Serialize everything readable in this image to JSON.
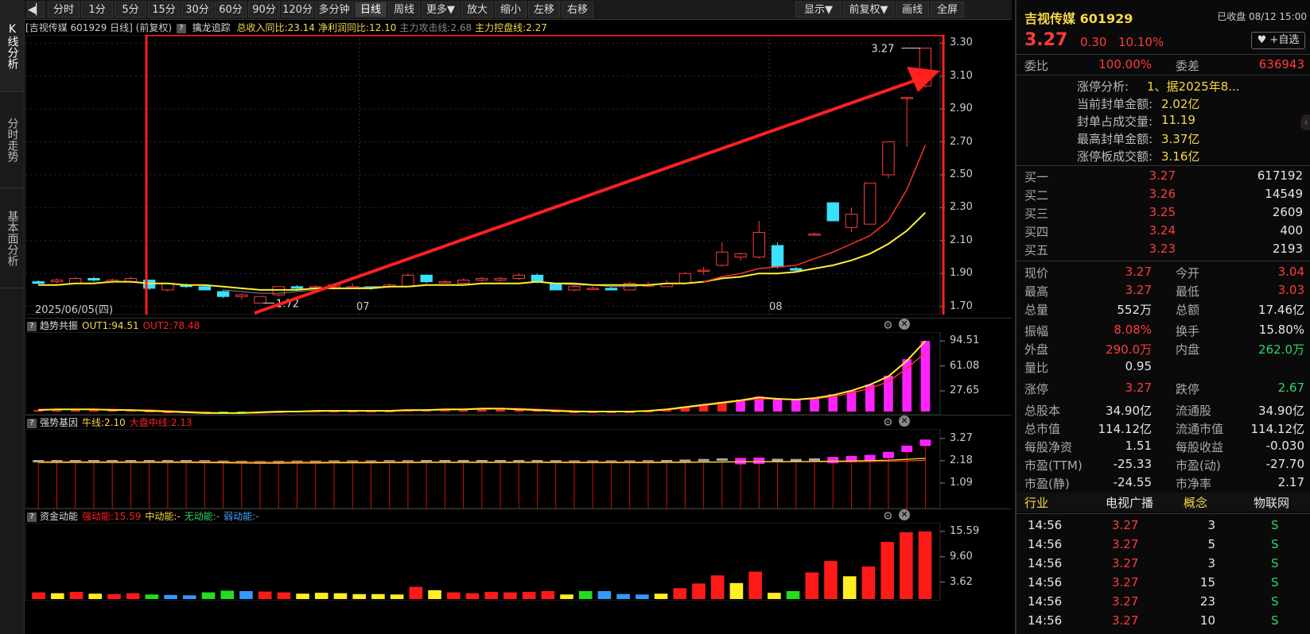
{
  "side_tabs": [
    "K线分析",
    "分时走势",
    "基本面分析"
  ],
  "toolbar": {
    "left_items": [
      "分时",
      "1分",
      "5分",
      "15分",
      "30分",
      "60分",
      "90分",
      "120分",
      "多分钟",
      "日线",
      "周线",
      "更多▼",
      "放大",
      "缩小",
      "左移",
      "右移"
    ],
    "active": "日线",
    "right_items": [
      "显示▼",
      "前复权▼",
      "画线",
      "全屏"
    ]
  },
  "main_panel": {
    "header_stock": "吉视传媒 601929 日线",
    "header_adj": "(前复权)",
    "indicator": "擒龙追踪",
    "items": [
      {
        "text": "总收入同比:23.14",
        "color": "#f7d84a"
      },
      {
        "text": "净利润同比:12.10",
        "color": "#f7d84a"
      },
      {
        "text": "主力攻击线:2.68",
        "color": "#888888"
      },
      {
        "text": "主力控盘线:2.27",
        "color": "#f7d84a"
      }
    ],
    "start_date": "2025/06/05(四)",
    "month_labels": [
      "07",
      "08"
    ],
    "low_label": "1.72",
    "high_label": "3.27",
    "y_ticks": [
      "3.30",
      "3.10",
      "2.90",
      "2.70",
      "2.50",
      "2.30",
      "2.10",
      "1.90",
      "1.70"
    ]
  },
  "sub_panels": [
    {
      "name": "趋势共振",
      "items": [
        {
          "text": "OUT1:94.51",
          "color": "#f7d84a"
        },
        {
          "text": "OUT2:78.48",
          "color": "#ff2020"
        }
      ],
      "ticks": [
        "94.51",
        "61.08",
        "27.65"
      ]
    },
    {
      "name": "强势基因",
      "items": [
        {
          "text": "牛线:2.10",
          "color": "#f7d84a"
        },
        {
          "text": "大盘中线:2.13",
          "color": "#ff2020"
        }
      ],
      "ticks": [
        "3.27",
        "2.18",
        "1.09"
      ]
    },
    {
      "name": "资金动能",
      "items": [
        {
          "text": "强动能:15.59",
          "color": "#ff2020"
        },
        {
          "text": "中动能:-",
          "color": "#f7d84a"
        },
        {
          "text": "无动能:-",
          "color": "#2fd66a"
        },
        {
          "text": "弱动能:-",
          "color": "#4aa3ff"
        }
      ],
      "ticks": [
        "15.59",
        "9.60",
        "3.62"
      ]
    }
  ],
  "chart_data": [
    {
      "type": "candlestick",
      "ylim": [
        1.65,
        3.35
      ],
      "candles": [
        {
          "o": 1.85,
          "h": 1.86,
          "l": 1.83,
          "c": 1.84
        },
        {
          "o": 1.85,
          "h": 1.87,
          "l": 1.84,
          "c": 1.86
        },
        {
          "o": 1.84,
          "h": 1.88,
          "l": 1.84,
          "c": 1.87
        },
        {
          "o": 1.87,
          "h": 1.88,
          "l": 1.85,
          "c": 1.86
        },
        {
          "o": 1.85,
          "h": 1.87,
          "l": 1.84,
          "c": 1.86
        },
        {
          "o": 1.85,
          "h": 1.88,
          "l": 1.84,
          "c": 1.87
        },
        {
          "o": 1.86,
          "h": 1.86,
          "l": 1.8,
          "c": 1.81
        },
        {
          "o": 1.8,
          "h": 1.84,
          "l": 1.79,
          "c": 1.84
        },
        {
          "o": 1.83,
          "h": 1.84,
          "l": 1.81,
          "c": 1.82
        },
        {
          "o": 1.82,
          "h": 1.83,
          "l": 1.8,
          "c": 1.8
        },
        {
          "o": 1.79,
          "h": 1.8,
          "l": 1.75,
          "c": 1.76
        },
        {
          "o": 1.76,
          "h": 1.78,
          "l": 1.74,
          "c": 1.77
        },
        {
          "o": 1.72,
          "h": 1.76,
          "l": 1.72,
          "c": 1.76
        },
        {
          "o": 1.77,
          "h": 1.82,
          "l": 1.76,
          "c": 1.82
        },
        {
          "o": 1.82,
          "h": 1.83,
          "l": 1.8,
          "c": 1.81
        },
        {
          "o": 1.82,
          "h": 1.83,
          "l": 1.8,
          "c": 1.82
        },
        {
          "o": 1.82,
          "h": 1.84,
          "l": 1.8,
          "c": 1.83
        },
        {
          "o": 1.82,
          "h": 1.84,
          "l": 1.81,
          "c": 1.82
        },
        {
          "o": 1.82,
          "h": 1.82,
          "l": 1.8,
          "c": 1.81
        },
        {
          "o": 1.82,
          "h": 1.84,
          "l": 1.81,
          "c": 1.83
        },
        {
          "o": 1.82,
          "h": 1.9,
          "l": 1.82,
          "c": 1.89
        },
        {
          "o": 1.89,
          "h": 1.89,
          "l": 1.84,
          "c": 1.85
        },
        {
          "o": 1.85,
          "h": 1.86,
          "l": 1.84,
          "c": 1.85
        },
        {
          "o": 1.84,
          "h": 1.87,
          "l": 1.84,
          "c": 1.86
        },
        {
          "o": 1.86,
          "h": 1.88,
          "l": 1.85,
          "c": 1.87
        },
        {
          "o": 1.86,
          "h": 1.88,
          "l": 1.85,
          "c": 1.87
        },
        {
          "o": 1.87,
          "h": 1.9,
          "l": 1.86,
          "c": 1.89
        },
        {
          "o": 1.89,
          "h": 1.9,
          "l": 1.84,
          "c": 1.85
        },
        {
          "o": 1.84,
          "h": 1.84,
          "l": 1.8,
          "c": 1.8
        },
        {
          "o": 1.8,
          "h": 1.83,
          "l": 1.79,
          "c": 1.82
        },
        {
          "o": 1.81,
          "h": 1.82,
          "l": 1.8,
          "c": 1.81
        },
        {
          "o": 1.81,
          "h": 1.82,
          "l": 1.8,
          "c": 1.8
        },
        {
          "o": 1.8,
          "h": 1.85,
          "l": 1.8,
          "c": 1.84
        },
        {
          "o": 1.83,
          "h": 1.85,
          "l": 1.82,
          "c": 1.83
        },
        {
          "o": 1.82,
          "h": 1.86,
          "l": 1.82,
          "c": 1.84
        },
        {
          "o": 1.84,
          "h": 1.91,
          "l": 1.84,
          "c": 1.9
        },
        {
          "o": 1.92,
          "h": 1.94,
          "l": 1.89,
          "c": 1.92
        },
        {
          "o": 1.95,
          "h": 2.09,
          "l": 1.94,
          "c": 2.03
        },
        {
          "o": 2.0,
          "h": 2.03,
          "l": 1.98,
          "c": 2.02
        },
        {
          "o": 2.0,
          "h": 2.22,
          "l": 1.99,
          "c": 2.15
        },
        {
          "o": 2.07,
          "h": 2.09,
          "l": 1.93,
          "c": 1.94
        },
        {
          "o": 1.93,
          "h": 1.94,
          "l": 1.91,
          "c": 1.92
        },
        {
          "o": 2.14,
          "h": 2.15,
          "l": 2.14,
          "c": 2.14
        },
        {
          "o": 2.33,
          "h": 2.33,
          "l": 2.22,
          "c": 2.22
        },
        {
          "o": 2.18,
          "h": 2.3,
          "l": 2.15,
          "c": 2.26
        },
        {
          "o": 2.2,
          "h": 2.45,
          "l": 2.2,
          "c": 2.45
        },
        {
          "o": 2.5,
          "h": 2.7,
          "l": 2.48,
          "c": 2.7
        },
        {
          "o": 2.97,
          "h": 2.97,
          "l": 2.67,
          "c": 2.97
        },
        {
          "o": 3.04,
          "h": 3.27,
          "l": 3.03,
          "c": 3.27
        }
      ],
      "ma_red": [
        null,
        null,
        null,
        null,
        null,
        null,
        null,
        null,
        null,
        null,
        null,
        null,
        null,
        null,
        null,
        null,
        null,
        null,
        null,
        null,
        null,
        null,
        null,
        null,
        null,
        null,
        null,
        null,
        null,
        null,
        null,
        null,
        null,
        null,
        null,
        null,
        1.85,
        1.88,
        1.9,
        1.93,
        1.94,
        1.95,
        1.99,
        2.03,
        2.08,
        2.13,
        2.22,
        2.41,
        2.68
      ],
      "ma_yellow": [
        1.83,
        1.83,
        1.84,
        1.84,
        1.85,
        1.85,
        1.84,
        1.84,
        1.83,
        1.83,
        1.82,
        1.81,
        1.8,
        1.8,
        1.8,
        1.81,
        1.81,
        1.81,
        1.81,
        1.82,
        1.82,
        1.83,
        1.83,
        1.83,
        1.84,
        1.84,
        1.84,
        1.85,
        1.84,
        1.84,
        1.83,
        1.83,
        1.83,
        1.83,
        1.84,
        1.84,
        1.85,
        1.87,
        1.88,
        1.9,
        1.9,
        1.91,
        1.93,
        1.95,
        1.98,
        2.02,
        2.08,
        2.16,
        2.27
      ],
      "ma_grey": [
        null,
        null,
        null,
        null,
        null,
        null,
        null,
        null,
        null,
        null,
        1.8,
        1.79,
        1.78,
        1.78,
        1.79,
        1.8,
        1.81,
        1.81,
        1.82,
        1.82,
        1.82,
        1.83,
        1.83,
        1.83,
        1.84,
        1.84,
        1.84,
        1.85,
        1.84,
        1.83,
        1.83,
        1.82,
        1.82,
        1.83,
        1.84,
        null,
        null,
        null,
        null,
        null,
        null,
        null,
        null,
        null,
        null,
        null,
        null,
        null,
        null
      ]
    },
    {
      "type": "bar",
      "ylim": [
        0,
        100
      ],
      "values": [
        2,
        3,
        3,
        3,
        2,
        2,
        1,
        0,
        0,
        -1,
        -2,
        -2,
        -1,
        0,
        1,
        1,
        1,
        1,
        1,
        1,
        2,
        2,
        3,
        3,
        4,
        4,
        3,
        2,
        1,
        0,
        0,
        0,
        0,
        1,
        3,
        6,
        9,
        13,
        16,
        20,
        17,
        16,
        18,
        23,
        28,
        36,
        48,
        70,
        94.51
      ],
      "line_yellow": [
        2,
        3,
        3,
        3,
        2,
        2,
        1,
        0,
        -1,
        -2,
        -2,
        -2,
        -1,
        0,
        0,
        1,
        1,
        1,
        1,
        1,
        2,
        2,
        3,
        3,
        4,
        4,
        3,
        2,
        1,
        0,
        0,
        0,
        0,
        1,
        3,
        6,
        9,
        12,
        15,
        19,
        17,
        16,
        18,
        22,
        28,
        36,
        47,
        68,
        94.51
      ],
      "line_red": [
        3,
        3,
        3,
        3,
        3,
        2,
        2,
        1,
        0,
        -1,
        -2,
        -2,
        -2,
        -1,
        0,
        0,
        1,
        1,
        1,
        1,
        1,
        2,
        2,
        3,
        3,
        4,
        4,
        3,
        2,
        1,
        0,
        0,
        0,
        1,
        2,
        5,
        8,
        11,
        14,
        17,
        17,
        16,
        17,
        20,
        25,
        31,
        40,
        58,
        78.48
      ]
    },
    {
      "type": "bar",
      "ylim": [
        0,
        3.5
      ],
      "values": [
        2.1,
        2.1,
        2.1,
        2.1,
        2.1,
        2.1,
        2.1,
        2.1,
        2.1,
        2.09,
        2.07,
        2.06,
        2.05,
        2.06,
        2.07,
        2.07,
        2.08,
        2.08,
        2.08,
        2.09,
        2.09,
        2.1,
        2.1,
        2.1,
        2.1,
        2.1,
        2.1,
        2.1,
        2.09,
        2.08,
        2.08,
        2.08,
        2.08,
        2.09,
        2.1,
        2.12,
        2.15,
        2.18,
        2.2,
        2.22,
        2.16,
        2.15,
        2.18,
        2.25,
        2.3,
        2.35,
        2.5,
        2.8,
        3.1
      ],
      "line_yellow": [
        2.1,
        2.1,
        2.1,
        2.1,
        2.1,
        2.1,
        2.1,
        2.1,
        2.1,
        2.09,
        2.08,
        2.07,
        2.06,
        2.06,
        2.07,
        2.07,
        2.08,
        2.08,
        2.08,
        2.09,
        2.09,
        2.1,
        2.1,
        2.1,
        2.1,
        2.1,
        2.1,
        2.1,
        2.1,
        2.09,
        2.09,
        2.09,
        2.09,
        2.09,
        2.1,
        2.1,
        2.11,
        2.12,
        2.13,
        2.14,
        2.14,
        2.14,
        2.15,
        2.16,
        2.17,
        2.19,
        2.21,
        2.25,
        2.3
      ],
      "line_red": [
        2.13,
        2.13,
        2.13,
        2.13,
        2.13,
        2.13,
        2.13,
        2.13,
        2.13,
        2.13,
        2.12,
        2.12,
        2.12,
        2.12,
        2.12,
        2.12,
        2.12,
        2.12,
        2.12,
        2.12,
        2.12,
        2.12,
        2.12,
        2.12,
        2.12,
        2.12,
        2.12,
        2.12,
        2.12,
        2.12,
        2.12,
        2.12,
        2.12,
        2.12,
        2.12,
        2.12,
        2.12,
        2.12,
        2.13,
        2.13,
        2.13,
        2.13,
        2.13,
        2.13,
        2.13,
        2.14,
        2.15,
        2.17,
        2.2
      ]
    },
    {
      "type": "bar",
      "ylim": [
        0,
        16.5
      ],
      "values": [
        1.2,
        1.0,
        1.3,
        0.9,
        0.8,
        1.0,
        0.7,
        0.6,
        0.5,
        1.2,
        1.6,
        1.5,
        1.4,
        1.2,
        0.9,
        1.1,
        1.0,
        0.8,
        0.8,
        0.7,
        2.5,
        1.7,
        1.2,
        1.0,
        1.3,
        1.2,
        1.3,
        1.5,
        0.7,
        1.5,
        1.5,
        0.8,
        0.7,
        0.9,
        2.2,
        3.3,
        5.2,
        3.4,
        6.1,
        1.1,
        1.5,
        5.9,
        8.6,
        5.0,
        7.3,
        13.1,
        15.4,
        15.59
      ],
      "colors": [
        "r",
        "y",
        "r",
        "y",
        "r",
        "r",
        "g",
        "b",
        "b",
        "g",
        "g",
        "b",
        "r",
        "r",
        "y",
        "y",
        "y",
        "y",
        "y",
        "y",
        "r",
        "y",
        "r",
        "r",
        "r",
        "r",
        "r",
        "r",
        "y",
        "g",
        "b",
        "b",
        "b",
        "y",
        "r",
        "r",
        "r",
        "y",
        "r",
        "y",
        "g",
        "r",
        "r",
        "y",
        "r",
        "r",
        "r",
        "r"
      ]
    }
  ],
  "quote": {
    "name": "吉视传媒 601929",
    "status": "已收盘 08/12 15:00",
    "price": "3.27",
    "change": "0.30",
    "pct": "10.10%",
    "add_watch": "+自选",
    "weibi_label": "委比",
    "weibi": "100.00%",
    "weicha_label": "委差",
    "weicha": "636943",
    "limit_info": [
      {
        "label": "涨停分析:",
        "value": "1、据2025年8..."
      },
      {
        "label": "当前封单金额:",
        "value": "2.02亿"
      },
      {
        "label": "封单占成交量:",
        "value": "11.19"
      },
      {
        "label": "最高封单金额:",
        "value": "3.37亿"
      },
      {
        "label": "涨停板成交额:",
        "value": "3.16亿"
      }
    ],
    "bids": [
      {
        "label": "买一",
        "price": "3.27",
        "vol": "617192"
      },
      {
        "label": "买二",
        "price": "3.26",
        "vol": "14549"
      },
      {
        "label": "买三",
        "price": "3.25",
        "vol": "2609"
      },
      {
        "label": "买四",
        "price": "3.24",
        "vol": "400"
      },
      {
        "label": "买五",
        "price": "3.23",
        "vol": "2193"
      }
    ],
    "stats": [
      [
        {
          "l": "现价",
          "v": "3.27",
          "c": "red"
        },
        {
          "l": "今开",
          "v": "3.04",
          "c": "red"
        }
      ],
      [
        {
          "l": "最高",
          "v": "3.27",
          "c": "red"
        },
        {
          "l": "最低",
          "v": "3.03",
          "c": "red"
        }
      ],
      [
        {
          "l": "总量",
          "v": "552万",
          "c": "white"
        },
        {
          "l": "总额",
          "v": "17.46亿",
          "c": "white"
        }
      ],
      [
        {
          "l": "振幅",
          "v": "8.08%",
          "c": "red"
        },
        {
          "l": "换手",
          "v": "15.80%",
          "c": "white"
        }
      ],
      [
        {
          "l": "外盘",
          "v": "290.0万",
          "c": "red"
        },
        {
          "l": "内盘",
          "v": "262.0万",
          "c": "green"
        }
      ],
      [
        {
          "l": "量比",
          "v": "0.95",
          "c": "white"
        },
        {
          "l": "",
          "v": "",
          "c": "white"
        }
      ],
      [
        {
          "l": "涨停",
          "v": "3.27",
          "c": "red"
        },
        {
          "l": "跌停",
          "v": "2.67",
          "c": "green"
        }
      ],
      [
        {
          "l": "总股本",
          "v": "34.90亿",
          "c": "white"
        },
        {
          "l": "流通股",
          "v": "34.90亿",
          "c": "white"
        }
      ],
      [
        {
          "l": "总市值",
          "v": "114.12亿",
          "c": "white"
        },
        {
          "l": "流通市值",
          "v": "114.12亿",
          "c": "white"
        }
      ],
      [
        {
          "l": "每股净资",
          "v": "1.51",
          "c": "white"
        },
        {
          "l": "每股收益",
          "v": "-0.030",
          "c": "white"
        }
      ],
      [
        {
          "l": "市盈(TTM)",
          "v": "-25.33",
          "c": "white"
        },
        {
          "l": "市盈(动)",
          "v": "-27.70",
          "c": "white"
        }
      ],
      [
        {
          "l": "市盈(静)",
          "v": "-24.55",
          "c": "white"
        },
        {
          "l": "市净率",
          "v": "2.17",
          "c": "white"
        }
      ]
    ],
    "industry": {
      "l1": "行业",
      "v1": "电视广播",
      "l2": "概念",
      "v2": "物联网"
    },
    "ticks": [
      {
        "t": "14:56",
        "p": "3.27",
        "v": "3",
        "d": "S"
      },
      {
        "t": "14:56",
        "p": "3.27",
        "v": "5",
        "d": "S"
      },
      {
        "t": "14:56",
        "p": "3.27",
        "v": "3",
        "d": "S"
      },
      {
        "t": "14:56",
        "p": "3.27",
        "v": "15",
        "d": "S"
      },
      {
        "t": "14:56",
        "p": "3.27",
        "v": "23",
        "d": "S"
      },
      {
        "t": "14:56",
        "p": "3.27",
        "v": "10",
        "d": "S"
      }
    ]
  }
}
